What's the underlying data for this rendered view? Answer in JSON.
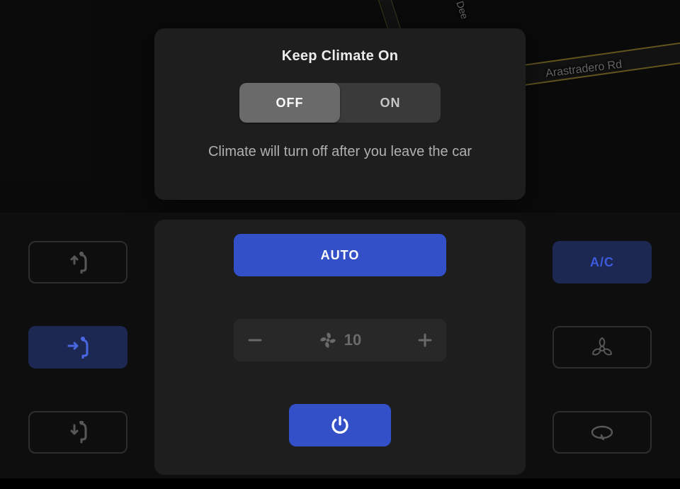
{
  "map": {
    "road1": "Arastradero Rd",
    "road2": "Dee"
  },
  "modal": {
    "title": "Keep Climate On",
    "off_label": "OFF",
    "on_label": "ON",
    "description": "Climate will turn off after you leave the car"
  },
  "climate": {
    "auto_label": "AUTO",
    "ac_label": "A/C",
    "fan_speed": "10"
  },
  "icons": {
    "airflow_up": "airflow-face-up",
    "airflow_mid": "airflow-face",
    "airflow_down": "airflow-feet",
    "biohazard": "bioweapon-defense",
    "recirc": "recirculate",
    "power": "power",
    "fan": "fan",
    "minus": "minus",
    "plus": "plus"
  }
}
